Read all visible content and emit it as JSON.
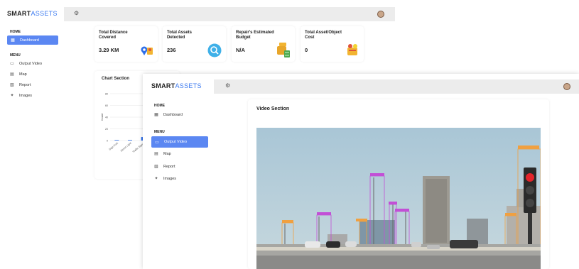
{
  "app": {
    "logo_part1": "SMART",
    "logo_part2": "ASSETS"
  },
  "sidebar": {
    "home_title": "HOME",
    "dashboard_label": "Dashboard",
    "menu_title": "MENU",
    "items": [
      {
        "label": "Output Video",
        "icon": "video-icon"
      },
      {
        "label": "Map",
        "icon": "map-icon"
      },
      {
        "label": "Report",
        "icon": "report-icon"
      },
      {
        "label": "Images",
        "icon": "images-icon"
      }
    ]
  },
  "stats": [
    {
      "title": "Total Distance Covered",
      "value": "3.29 KM",
      "icon": "map-pin-icon"
    },
    {
      "title": "Total Assets Detected",
      "value": "236",
      "icon": "search-icon"
    },
    {
      "title": "Repair's Estimated Budget",
      "value": "N/A",
      "icon": "money-icon"
    },
    {
      "title": "Total Asset/Object Cost",
      "value": "0",
      "icon": "coins-icon"
    }
  ],
  "chart_section": {
    "title": "Chart Section",
    "ylabel": "Count",
    "yticks": [
      "80",
      "60",
      "40",
      "20",
      "0"
    ],
    "categories": [
      "Sign Post",
      "Street Light",
      "Traffic Signal"
    ]
  },
  "video_section": {
    "title": "Video Section"
  },
  "chart_data": {
    "type": "bar",
    "title": "Chart Section",
    "ylabel": "Count",
    "categories": [
      "Sign Post",
      "Street Light",
      "Traffic Signal"
    ],
    "values": [
      1,
      1,
      6
    ],
    "ylim": [
      0,
      80
    ],
    "colors": [
      "#2f6fe8"
    ]
  },
  "colors": {
    "accent": "#3d7bf0",
    "active_nav": "#5b87f2",
    "topbar": "#ececec"
  }
}
